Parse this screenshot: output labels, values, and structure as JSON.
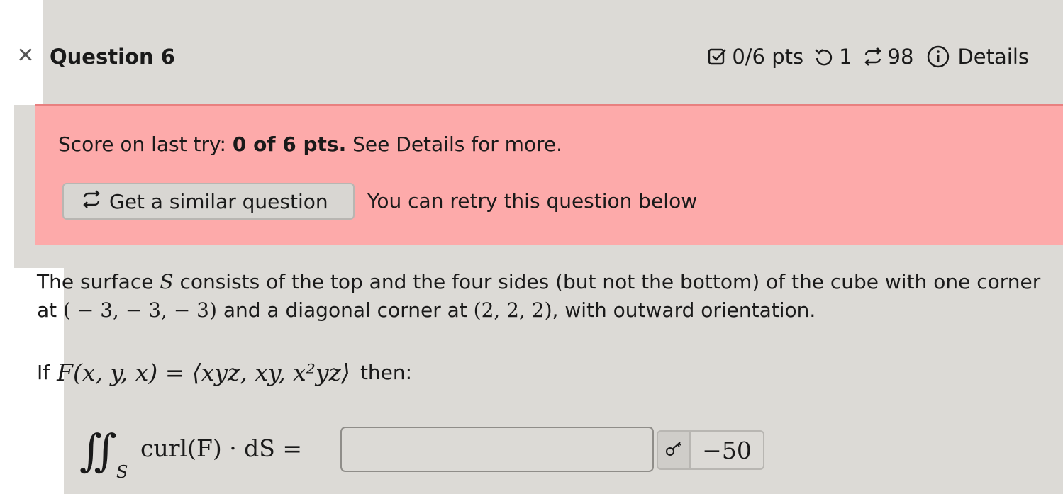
{
  "header": {
    "title": "Question 6",
    "points": "0/6 pts",
    "attempts": "1",
    "retries": "98",
    "details_label": "Details"
  },
  "alert": {
    "score_prefix": "Score on last try: ",
    "score_bold": "0 of 6 pts.",
    "score_suffix": " See Details for more.",
    "similar_button_label": "Get a similar question",
    "retry_text": "You can retry this question below"
  },
  "question": {
    "p1_a": "The surface ",
    "p1_S": "S",
    "p1_b": " consists of the top and the four sides (but not the bottom) of the cube with one corner at ",
    "corner1": "( − 3,  − 3,  − 3)",
    "p1_c": " and a diagonal corner at ",
    "corner2": "(2, 2, 2)",
    "p1_d": ", with outward orientation.",
    "if_label": "If",
    "field_expr": "F(x, y, x) = ⟨xyz, xy, x²yz⟩",
    "then_label": "then:",
    "integral_sign": "∬",
    "integral_sub": "S",
    "integral_body": "curl(F) · dS =",
    "answer_value": "",
    "key_answer": "−50"
  },
  "colors": {
    "alert_bg": "#fdaaaa",
    "alert_border": "#e88080",
    "page_bg": "#dcdad6"
  }
}
